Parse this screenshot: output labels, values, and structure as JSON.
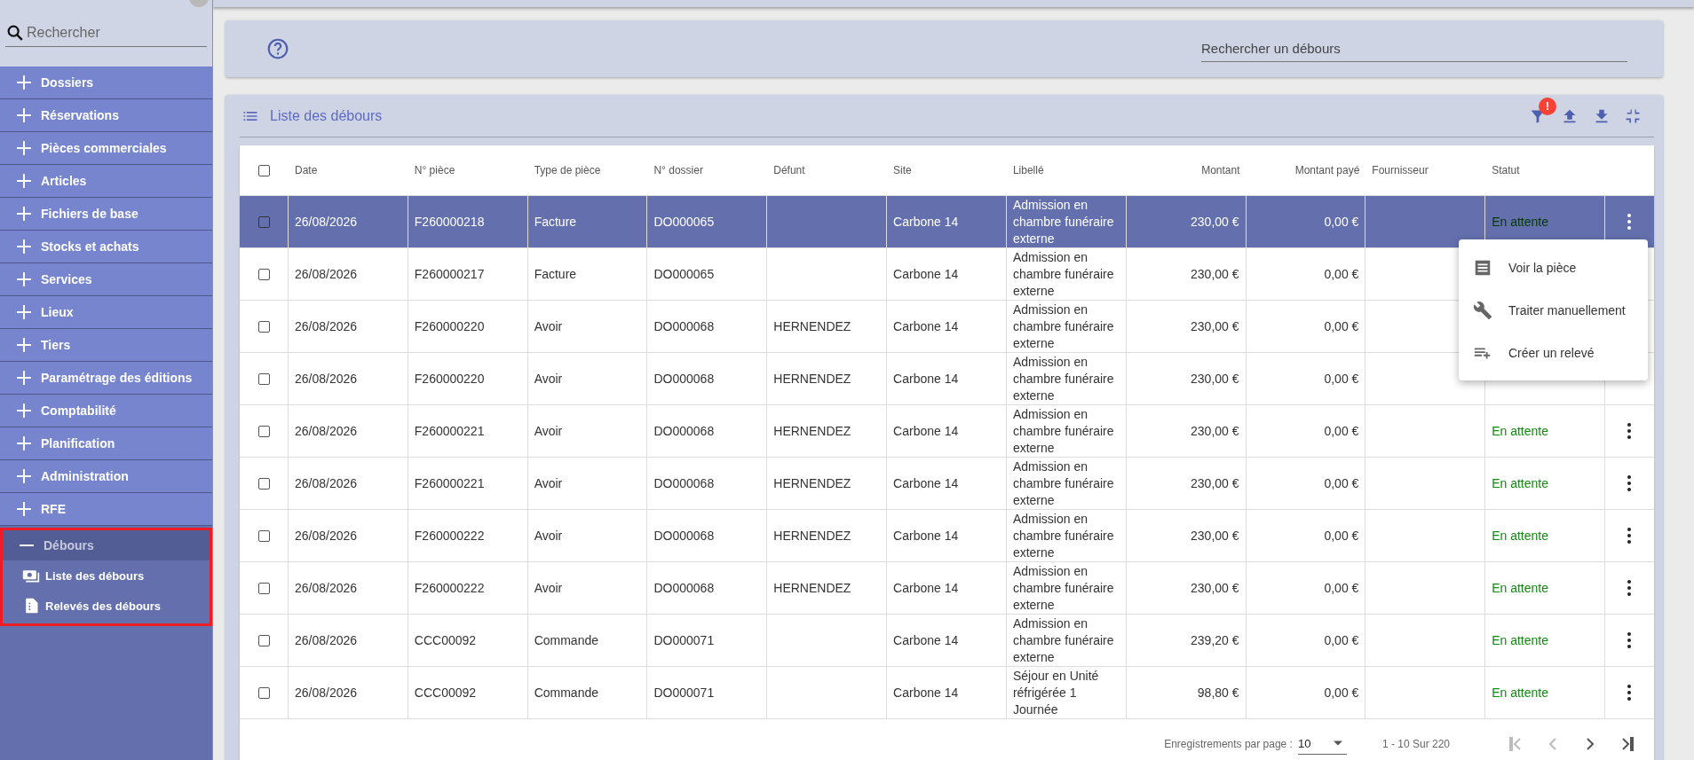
{
  "sidebar": {
    "search": {
      "placeholder": "Rechercher"
    },
    "items": [
      {
        "label": "Dossiers",
        "expanded": false
      },
      {
        "label": "Réservations",
        "expanded": false
      },
      {
        "label": "Pièces commerciales",
        "expanded": false
      },
      {
        "label": "Articles",
        "expanded": false
      },
      {
        "label": "Fichiers de base",
        "expanded": false
      },
      {
        "label": "Stocks et achats",
        "expanded": false
      },
      {
        "label": "Services",
        "expanded": false
      },
      {
        "label": "Lieux",
        "expanded": false
      },
      {
        "label": "Tiers",
        "expanded": false
      },
      {
        "label": "Paramétrage des éditions",
        "expanded": false
      },
      {
        "label": "Comptabilité",
        "expanded": false
      },
      {
        "label": "Planification",
        "expanded": false
      },
      {
        "label": "Administration",
        "expanded": false
      },
      {
        "label": "RFE",
        "expanded": false
      },
      {
        "label": "Débours",
        "expanded": true,
        "highlighted": true,
        "children": [
          {
            "label": "Liste des débours",
            "kind": "money"
          },
          {
            "label": "Relevés des débours",
            "kind": "file"
          }
        ]
      }
    ]
  },
  "header": {
    "search": {
      "placeholder": "Rechercher un débours"
    }
  },
  "list": {
    "title": "Liste des débours",
    "filter_badge": "!",
    "all_checked": false,
    "columns": [
      {
        "label": "Date",
        "kind": "text"
      },
      {
        "label": "N° pièce",
        "kind": "text"
      },
      {
        "label": "Type de pièce",
        "kind": "text"
      },
      {
        "label": "N° dossier",
        "kind": "text"
      },
      {
        "label": "Défunt",
        "kind": "text"
      },
      {
        "label": "Site",
        "kind": "text"
      },
      {
        "label": "Libellé",
        "kind": "text"
      },
      {
        "label": "Montant",
        "kind": "amount"
      },
      {
        "label": "Montant payé",
        "kind": "amount"
      },
      {
        "label": "Fournisseur",
        "kind": "text"
      },
      {
        "label": "Statut",
        "kind": "status"
      }
    ],
    "rows": [
      {
        "selected": true,
        "checked": false,
        "menu_button": true,
        "cells": [
          "26/08/2026",
          "F260000218",
          "Facture",
          "DO000065",
          null,
          "Carbone 14",
          "Admission en chambre funéraire externe",
          "230,00 €",
          "0,00 €",
          null,
          "En attente"
        ]
      },
      {
        "selected": false,
        "checked": false,
        "menu_button": false,
        "cells": [
          "26/08/2026",
          "F260000217",
          "Facture",
          "DO000065",
          null,
          "Carbone 14",
          "Admission en chambre funéraire externe",
          "230,00 €",
          "0,00 €",
          null,
          null
        ]
      },
      {
        "selected": false,
        "checked": false,
        "menu_button": false,
        "cells": [
          "26/08/2026",
          "F260000220",
          "Avoir",
          "DO000068",
          "HERNENDEZ",
          "Carbone 14",
          "Admission en chambre funéraire externe",
          "230,00 €",
          "0,00 €",
          null,
          null
        ]
      },
      {
        "selected": false,
        "checked": false,
        "menu_button": false,
        "cells": [
          "26/08/2026",
          "F260000220",
          "Avoir",
          "DO000068",
          "HERNENDEZ",
          "Carbone 14",
          "Admission en chambre funéraire externe",
          "230,00 €",
          "0,00 €",
          null,
          null
        ]
      },
      {
        "selected": false,
        "checked": false,
        "menu_button": true,
        "cells": [
          "26/08/2026",
          "F260000221",
          "Avoir",
          "DO000068",
          "HERNENDEZ",
          "Carbone 14",
          "Admission en chambre funéraire externe",
          "230,00 €",
          "0,00 €",
          null,
          "En attente"
        ]
      },
      {
        "selected": false,
        "checked": false,
        "menu_button": true,
        "cells": [
          "26/08/2026",
          "F260000221",
          "Avoir",
          "DO000068",
          "HERNENDEZ",
          "Carbone 14",
          "Admission en chambre funéraire externe",
          "230,00 €",
          "0,00 €",
          null,
          "En attente"
        ]
      },
      {
        "selected": false,
        "checked": false,
        "menu_button": true,
        "cells": [
          "26/08/2026",
          "F260000222",
          "Avoir",
          "DO000068",
          "HERNENDEZ",
          "Carbone 14",
          "Admission en chambre funéraire externe",
          "230,00 €",
          "0,00 €",
          null,
          "En attente"
        ]
      },
      {
        "selected": false,
        "checked": false,
        "menu_button": true,
        "cells": [
          "26/08/2026",
          "F260000222",
          "Avoir",
          "DO000068",
          "HERNENDEZ",
          "Carbone 14",
          "Admission en chambre funéraire externe",
          "230,00 €",
          "0,00 €",
          null,
          "En attente"
        ]
      },
      {
        "selected": false,
        "checked": false,
        "menu_button": true,
        "cells": [
          "26/08/2026",
          "CCC00092",
          "Commande",
          "DO000071",
          null,
          "Carbone 14",
          "Admission en chambre funéraire externe",
          "239,20 €",
          "0,00 €",
          null,
          "En attente"
        ]
      },
      {
        "selected": false,
        "checked": false,
        "menu_button": true,
        "cells": [
          "26/08/2026",
          "CCC00092",
          "Commande",
          "DO000071",
          null,
          "Carbone 14",
          "Séjour en Unité réfrigérée 1 Journée",
          "98,80 €",
          "0,00 €",
          null,
          "En attente"
        ]
      }
    ],
    "row_menu": {
      "items": [
        {
          "label": "Voir la pièce",
          "kind": "document"
        },
        {
          "label": "Traiter manuellement",
          "kind": "wrench"
        },
        {
          "label": "Créer un relevé",
          "kind": "playlist-add"
        }
      ]
    },
    "pagination": {
      "label": "Enregistrements par page :",
      "page_size": "10",
      "range": "1 - 10 Sur 220",
      "buttons": [
        {
          "kind": "first",
          "disabled": true
        },
        {
          "kind": "prev",
          "disabled": true
        },
        {
          "kind": "next",
          "disabled": false
        },
        {
          "kind": "last",
          "disabled": false
        }
      ]
    }
  }
}
